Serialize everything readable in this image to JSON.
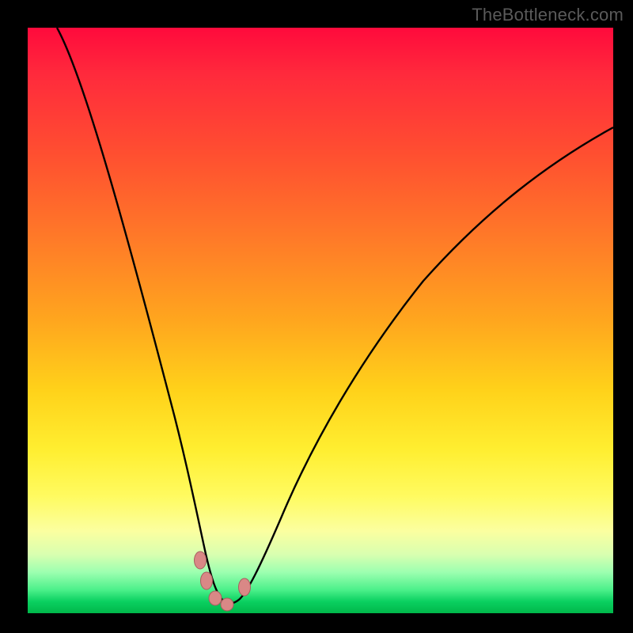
{
  "watermark": {
    "text": "TheBottleneck.com"
  },
  "colors": {
    "frame": "#000000",
    "curve": "#000000",
    "marker_fill": "#d98886",
    "marker_stroke": "#a86060",
    "gradient_stops": [
      "#ff0a3c",
      "#ff2a3c",
      "#ff5030",
      "#ff7a28",
      "#ffa61e",
      "#ffd21a",
      "#ffee30",
      "#fffb60",
      "#fbffa0",
      "#d8ffb0",
      "#9cffb0",
      "#4cf08a",
      "#0ad060",
      "#00b84a"
    ]
  },
  "chart_data": {
    "type": "line",
    "title": "",
    "xlabel": "",
    "ylabel": "",
    "xlim": [
      0,
      100
    ],
    "ylim": [
      0,
      100
    ],
    "note": "x and y are percentage coordinates of the plot area (0=left/top edge of gradient, 100=right/bottom). Gradient maps bottleneck severity: red≈100 (bad) at top, green≈0 (good) at bottom. Curve traces bottleneck % vs an implicit horizontal parameter; valley ≈ optimal match.",
    "series": [
      {
        "name": "bottleneck-curve",
        "x": [
          5,
          8,
          11,
          14,
          17,
          20,
          23,
          25,
          27,
          29,
          30.5,
          32,
          33.5,
          35.5,
          38,
          41,
          45,
          50,
          55,
          60,
          66,
          73,
          81,
          90,
          100
        ],
        "y": [
          0,
          12,
          24,
          36,
          47,
          58,
          68,
          76,
          83,
          89,
          93.5,
          96.5,
          98.5,
          98.5,
          96,
          91,
          83,
          73,
          64,
          56,
          48,
          40,
          32,
          24,
          17
        ]
      }
    ],
    "markers": [
      {
        "name": "valley-left-1",
        "x": 29.5,
        "y": 91.0
      },
      {
        "name": "valley-left-2",
        "x": 30.5,
        "y": 94.5
      },
      {
        "name": "valley-bottom-1",
        "x": 32.0,
        "y": 97.5
      },
      {
        "name": "valley-bottom-2",
        "x": 34.0,
        "y": 98.5
      },
      {
        "name": "valley-right",
        "x": 37.0,
        "y": 95.5
      }
    ]
  }
}
